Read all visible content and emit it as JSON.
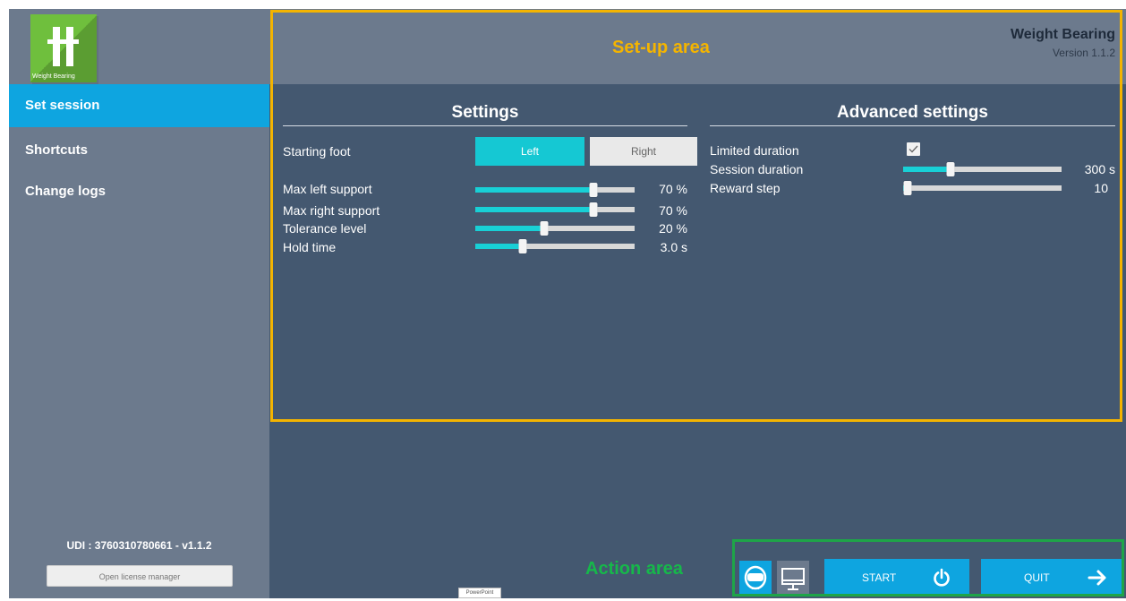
{
  "app": {
    "title": "Weight Bearing",
    "version": "Version 1.1.2",
    "logo_text": "Weight Bearing"
  },
  "annotations": {
    "setup_area": "Set-up area",
    "action_area": "Action area"
  },
  "sidebar": {
    "items": [
      {
        "label": "Set session",
        "active": true
      },
      {
        "label": "Shortcuts",
        "active": false
      },
      {
        "label": "Change logs",
        "active": false
      }
    ],
    "udi": "UDI : 3760310780661 - v1.1.2",
    "license_button": "Open license manager"
  },
  "settings": {
    "title": "Settings",
    "starting_foot": {
      "label": "Starting foot",
      "options": [
        "Left",
        "Right"
      ],
      "selected": "Left"
    },
    "sliders": [
      {
        "label": "Max left support",
        "value": 70,
        "value_text": "70 %",
        "fraction": 0.74
      },
      {
        "label": "Max right support",
        "value": 70,
        "value_text": "70 %",
        "fraction": 0.74
      },
      {
        "label": "Tolerance level",
        "value": 20,
        "value_text": "20 %",
        "fraction": 0.43
      },
      {
        "label": "Hold time",
        "value": 3.0,
        "value_text": "3.0 s",
        "fraction": 0.3
      }
    ]
  },
  "advanced": {
    "title": "Advanced settings",
    "limited_duration": {
      "label": "Limited duration",
      "checked": true
    },
    "session_duration": {
      "label": "Session duration",
      "value": 300,
      "value_text": "300 s",
      "fraction": 0.3
    },
    "reward_step": {
      "label": "Reward step",
      "value": 10,
      "value_text": "10",
      "fraction": 0.03
    }
  },
  "actions": {
    "modes": [
      "headset-icon",
      "monitor-icon"
    ],
    "start_label": "START",
    "quit_label": "QUIT"
  },
  "taskbar": {
    "label": "PowerPoint"
  },
  "colors": {
    "sidebar": "#6c7a8d",
    "main": "#445870",
    "accent": "#0ea5e0",
    "cyan": "#18d0d6",
    "setup_frame": "#f4b400",
    "action_frame": "#1ea548",
    "logo_green": "#6fbf3d"
  }
}
